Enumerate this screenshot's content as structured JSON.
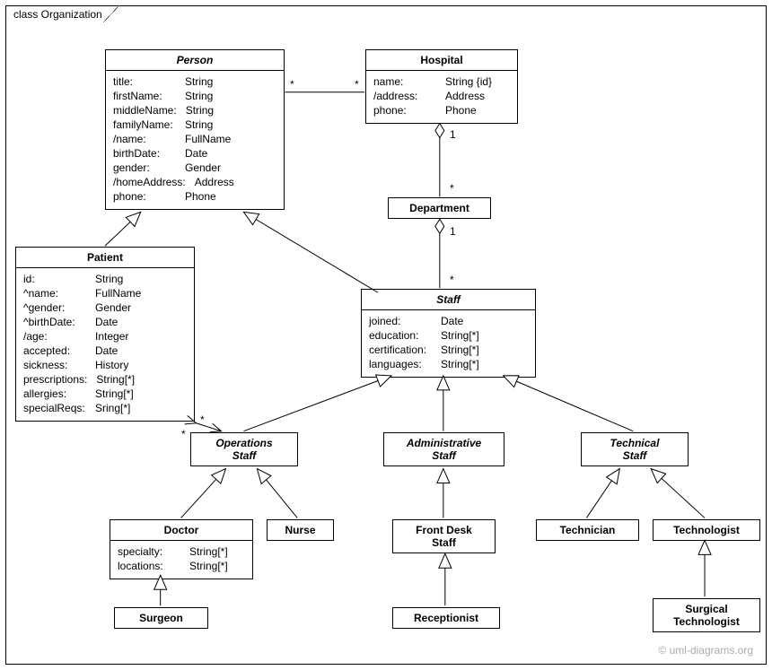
{
  "frame": {
    "label": "class Organization"
  },
  "classes": {
    "person": {
      "title": "Person",
      "attrs": [
        {
          "k": "title:",
          "v": "String"
        },
        {
          "k": "firstName:",
          "v": "String"
        },
        {
          "k": "middleName:",
          "v": "String"
        },
        {
          "k": "familyName:",
          "v": "String"
        },
        {
          "k": "/name:",
          "v": "FullName"
        },
        {
          "k": "birthDate:",
          "v": "Date"
        },
        {
          "k": "gender:",
          "v": "Gender"
        },
        {
          "k": "/homeAddress:",
          "v": "Address"
        },
        {
          "k": "phone:",
          "v": "Phone"
        }
      ]
    },
    "hospital": {
      "title": "Hospital",
      "attrs": [
        {
          "k": "name:",
          "v": "String {id}"
        },
        {
          "k": "/address:",
          "v": "Address"
        },
        {
          "k": "phone:",
          "v": "Phone"
        }
      ]
    },
    "department": {
      "title": "Department"
    },
    "patient": {
      "title": "Patient",
      "attrs": [
        {
          "k": "id:",
          "v": "String"
        },
        {
          "k": "^name:",
          "v": "FullName"
        },
        {
          "k": "^gender:",
          "v": "Gender"
        },
        {
          "k": "^birthDate:",
          "v": "Date"
        },
        {
          "k": "/age:",
          "v": "Integer"
        },
        {
          "k": "accepted:",
          "v": "Date"
        },
        {
          "k": "sickness:",
          "v": "History"
        },
        {
          "k": "prescriptions:",
          "v": "String[*]"
        },
        {
          "k": "allergies:",
          "v": "String[*]"
        },
        {
          "k": "specialReqs:",
          "v": "Sring[*]"
        }
      ]
    },
    "staff": {
      "title": "Staff",
      "attrs": [
        {
          "k": "joined:",
          "v": "Date"
        },
        {
          "k": "education:",
          "v": "String[*]"
        },
        {
          "k": "certification:",
          "v": "String[*]"
        },
        {
          "k": "languages:",
          "v": "String[*]"
        }
      ]
    },
    "operations_staff": {
      "title_lines": [
        "Operations",
        "Staff"
      ]
    },
    "administrative_staff": {
      "title_lines": [
        "Administrative",
        "Staff"
      ]
    },
    "technical_staff": {
      "title_lines": [
        "Technical",
        "Staff"
      ]
    },
    "doctor": {
      "title": "Doctor",
      "attrs": [
        {
          "k": "specialty:",
          "v": "String[*]"
        },
        {
          "k": "locations:",
          "v": "String[*]"
        }
      ]
    },
    "nurse": {
      "title": "Nurse"
    },
    "front_desk_staff": {
      "title_lines": [
        "Front Desk",
        "Staff"
      ]
    },
    "technician": {
      "title": "Technician"
    },
    "technologist": {
      "title": "Technologist"
    },
    "surgeon": {
      "title": "Surgeon"
    },
    "receptionist": {
      "title": "Receptionist"
    },
    "surgical_technologist": {
      "title_lines": [
        "Surgical",
        "Technologist"
      ]
    }
  },
  "multiplicities": {
    "person_patient_person": "*",
    "person_patient_patient": "*",
    "person_hospital_person": "*",
    "person_hospital_hospital": "*",
    "hospital_department_h": "1",
    "hospital_department_d": "*",
    "department_staff_d": "1",
    "department_staff_s": "*"
  },
  "footer": "© uml-diagrams.org"
}
